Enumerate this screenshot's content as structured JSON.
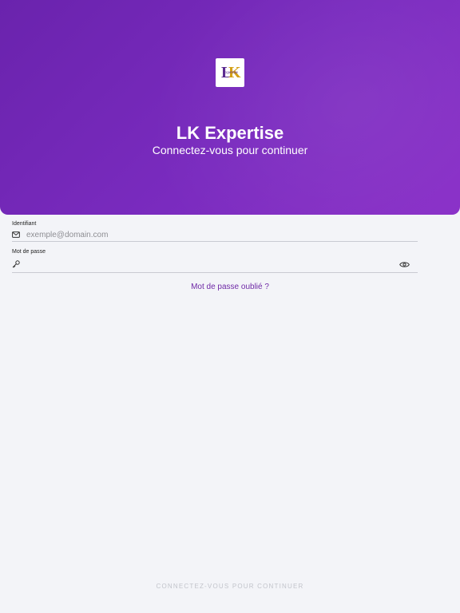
{
  "header": {
    "logo_letters": "LK",
    "logo_word": "Expertise",
    "title": "LK Expertise",
    "subtitle": "Connectez-vous pour continuer"
  },
  "form": {
    "identifier": {
      "label": "Identifiant",
      "placeholder": "exemple@domain.com",
      "value": "",
      "icon": "mail-icon"
    },
    "password": {
      "label": "Mot de passe",
      "placeholder": "",
      "value": "",
      "icon": "key-icon",
      "toggle_icon": "eye-icon"
    },
    "forgot_link": "Mot de passe oublié ?",
    "submit_label": "CONNECTEZ-VOUS POUR CONTINUER"
  },
  "colors": {
    "brand": "#7a2bbf",
    "link": "#6f2aa6",
    "background": "#f3f4f8"
  }
}
